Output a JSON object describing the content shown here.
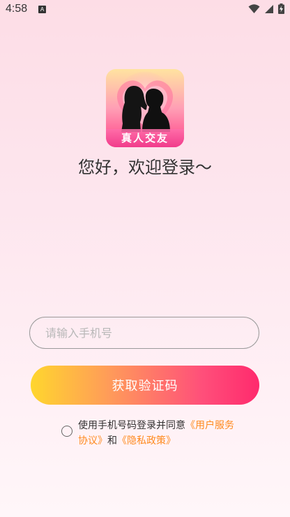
{
  "status_bar": {
    "time": "4:58",
    "badge": "A"
  },
  "logo": {
    "label": "真人交友"
  },
  "welcome": "您好，欢迎登录～",
  "phone": {
    "placeholder": "请输入手机号",
    "value": ""
  },
  "get_code_label": "获取验证码",
  "agreement": {
    "prefix": "使用手机号码登录并同意",
    "user_service": "《用户服务协议》",
    "and": "和",
    "privacy": "《隐私政策》"
  },
  "colors": {
    "link": "#ff8a1e",
    "button_start": "#ffd62e",
    "button_end": "#ff2a6d"
  }
}
